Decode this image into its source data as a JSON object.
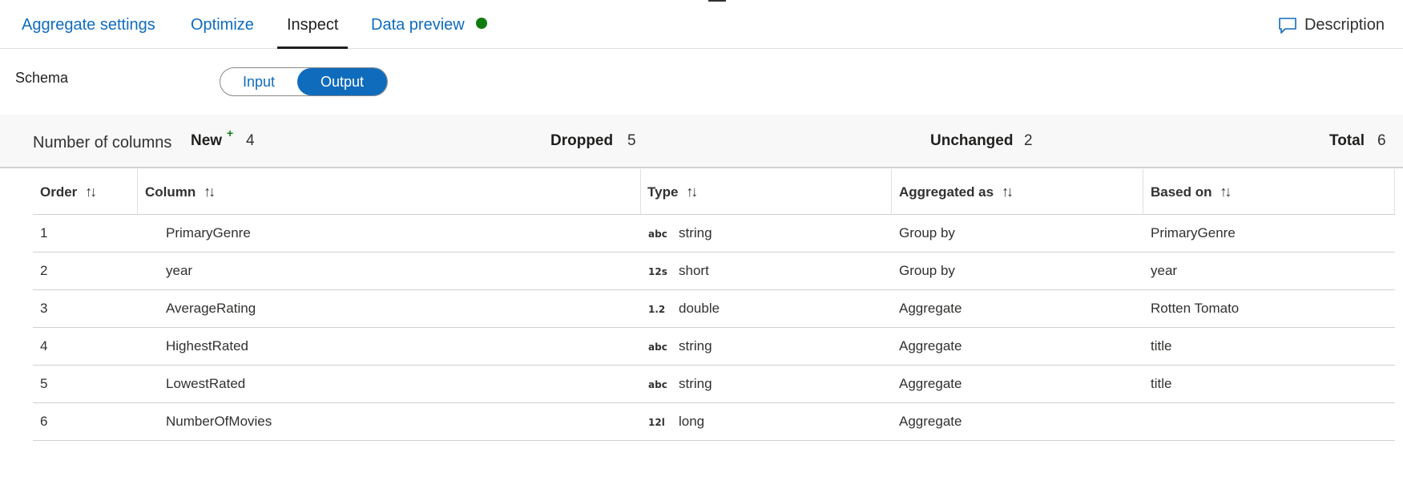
{
  "tabs": [
    {
      "label": "Aggregate settings"
    },
    {
      "label": "Optimize"
    },
    {
      "label": "Inspect"
    },
    {
      "label": "Data preview"
    }
  ],
  "description_label": "Description",
  "schema": {
    "label": "Schema",
    "toggle": {
      "input_label": "Input",
      "output_label": "Output",
      "selected": "Output"
    }
  },
  "summary": {
    "label": "Number of columns",
    "new_label": "New",
    "new_marker": "+",
    "new_value": "4",
    "dropped_label": "Dropped",
    "dropped_value": "5",
    "unchanged_label": "Unchanged",
    "unchanged_value": "2",
    "total_label": "Total",
    "total_value": "6"
  },
  "table": {
    "sort_glyph": "↑↓",
    "headers": [
      "Order",
      "Column",
      "Type",
      "Aggregated as",
      "Based on"
    ],
    "rows": [
      {
        "order": "1",
        "column": "PrimaryGenre",
        "type_icon": "abc",
        "type": "string",
        "agg": "Group by",
        "based_on": "PrimaryGenre"
      },
      {
        "order": "2",
        "column": "year",
        "type_icon": "12s",
        "type": "short",
        "agg": "Group by",
        "based_on": "year"
      },
      {
        "order": "3",
        "column": "AverageRating",
        "type_icon": "1.2",
        "type": "double",
        "agg": "Aggregate",
        "based_on": "Rotten Tomato"
      },
      {
        "order": "4",
        "column": "HighestRated",
        "type_icon": "abc",
        "type": "string",
        "agg": "Aggregate",
        "based_on": "title"
      },
      {
        "order": "5",
        "column": "LowestRated",
        "type_icon": "abc",
        "type": "string",
        "agg": "Aggregate",
        "based_on": "title"
      },
      {
        "order": "6",
        "column": "NumberOfMovies",
        "type_icon": "12l",
        "type": "long",
        "agg": "Aggregate",
        "based_on": ""
      }
    ]
  },
  "colors": {
    "accent": "#0f6cbd",
    "status_ok": "#107c10",
    "new_marker": "#107c10"
  }
}
